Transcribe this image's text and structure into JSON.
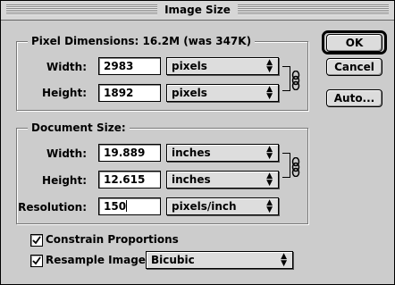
{
  "window": {
    "title": "Image Size"
  },
  "pixel_dimensions": {
    "label": "Pixel Dimensions:",
    "size_summary": "16.2M (was 347K)",
    "width": {
      "label": "Width:",
      "value": "2983",
      "unit": "pixels"
    },
    "height": {
      "label": "Height:",
      "value": "1892",
      "unit": "pixels"
    }
  },
  "document_size": {
    "label": "Document Size:",
    "width": {
      "label": "Width:",
      "value": "19.889",
      "unit": "inches"
    },
    "height": {
      "label": "Height:",
      "value": "12.615",
      "unit": "inches"
    },
    "resolution": {
      "label": "Resolution:",
      "value": "150",
      "unit": "pixels/inch"
    }
  },
  "options": {
    "constrain_proportions": {
      "label": "Constrain Proportions",
      "checked": true
    },
    "resample_image": {
      "label": "Resample Image:",
      "checked": true,
      "method": "Bicubic"
    }
  },
  "buttons": {
    "ok": "OK",
    "cancel": "Cancel",
    "auto": "Auto..."
  },
  "icons": {
    "popup_arrows": "up-down-arrows-icon",
    "link": "chain-link-icon",
    "check": "checkmark-icon"
  }
}
